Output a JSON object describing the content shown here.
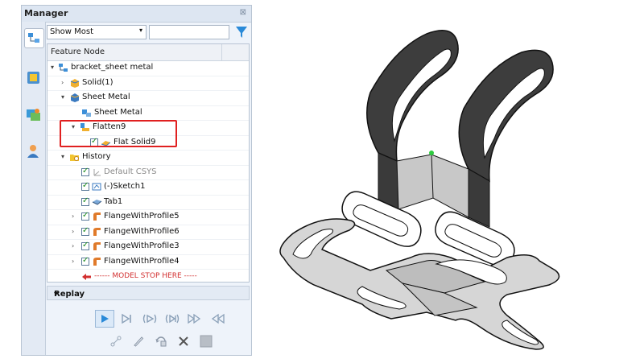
{
  "manager": {
    "title": "Manager",
    "close_glyph": "⊠",
    "filter": {
      "selected": "Show Most",
      "search_value": ""
    },
    "tree": {
      "header": "Feature Node",
      "rows": [
        {
          "label": "bracket_sheet metal",
          "icon": "assembly-icon",
          "expand": "▾"
        },
        {
          "label": "Solid(1)",
          "icon": "solid-icon",
          "expand": "›"
        },
        {
          "label": "Sheet Metal",
          "icon": "sheet-metal-icon",
          "expand": "▾"
        },
        {
          "label": "Sheet Metal",
          "icon": "sheet-metal-feature-icon"
        },
        {
          "label": "Flatten9",
          "icon": "flatten-icon",
          "expand": "▾"
        },
        {
          "label": "Flat Solid9",
          "icon": "flat-solid-icon",
          "checked": true
        },
        {
          "label": "History",
          "icon": "history-folder-icon",
          "expand": "▾"
        },
        {
          "label": "Default CSYS",
          "icon": "csys-icon",
          "checked": true
        },
        {
          "label": "(-)Sketch1",
          "icon": "sketch-icon",
          "checked": true
        },
        {
          "label": "Tab1",
          "icon": "tab-icon",
          "checked": true
        },
        {
          "label": "FlangeWithProfile5",
          "icon": "flange-icon",
          "checked": true,
          "expand": "›"
        },
        {
          "label": "FlangeWithProfile6",
          "icon": "flange-icon",
          "checked": true,
          "expand": "›"
        },
        {
          "label": "FlangeWithProfile3",
          "icon": "flange-icon",
          "checked": true,
          "expand": "›"
        },
        {
          "label": "FlangeWithProfile4",
          "icon": "flange-icon",
          "checked": true,
          "expand": "›"
        },
        {
          "label": "------ MODEL STOP HERE -----",
          "icon": "arrow-left-icon"
        }
      ]
    },
    "replay": {
      "title": "Replay",
      "expand": "▾"
    }
  },
  "colors": {
    "highlight": "#e02020",
    "accent": "#2a8ad8",
    "stop": "#d23030"
  }
}
